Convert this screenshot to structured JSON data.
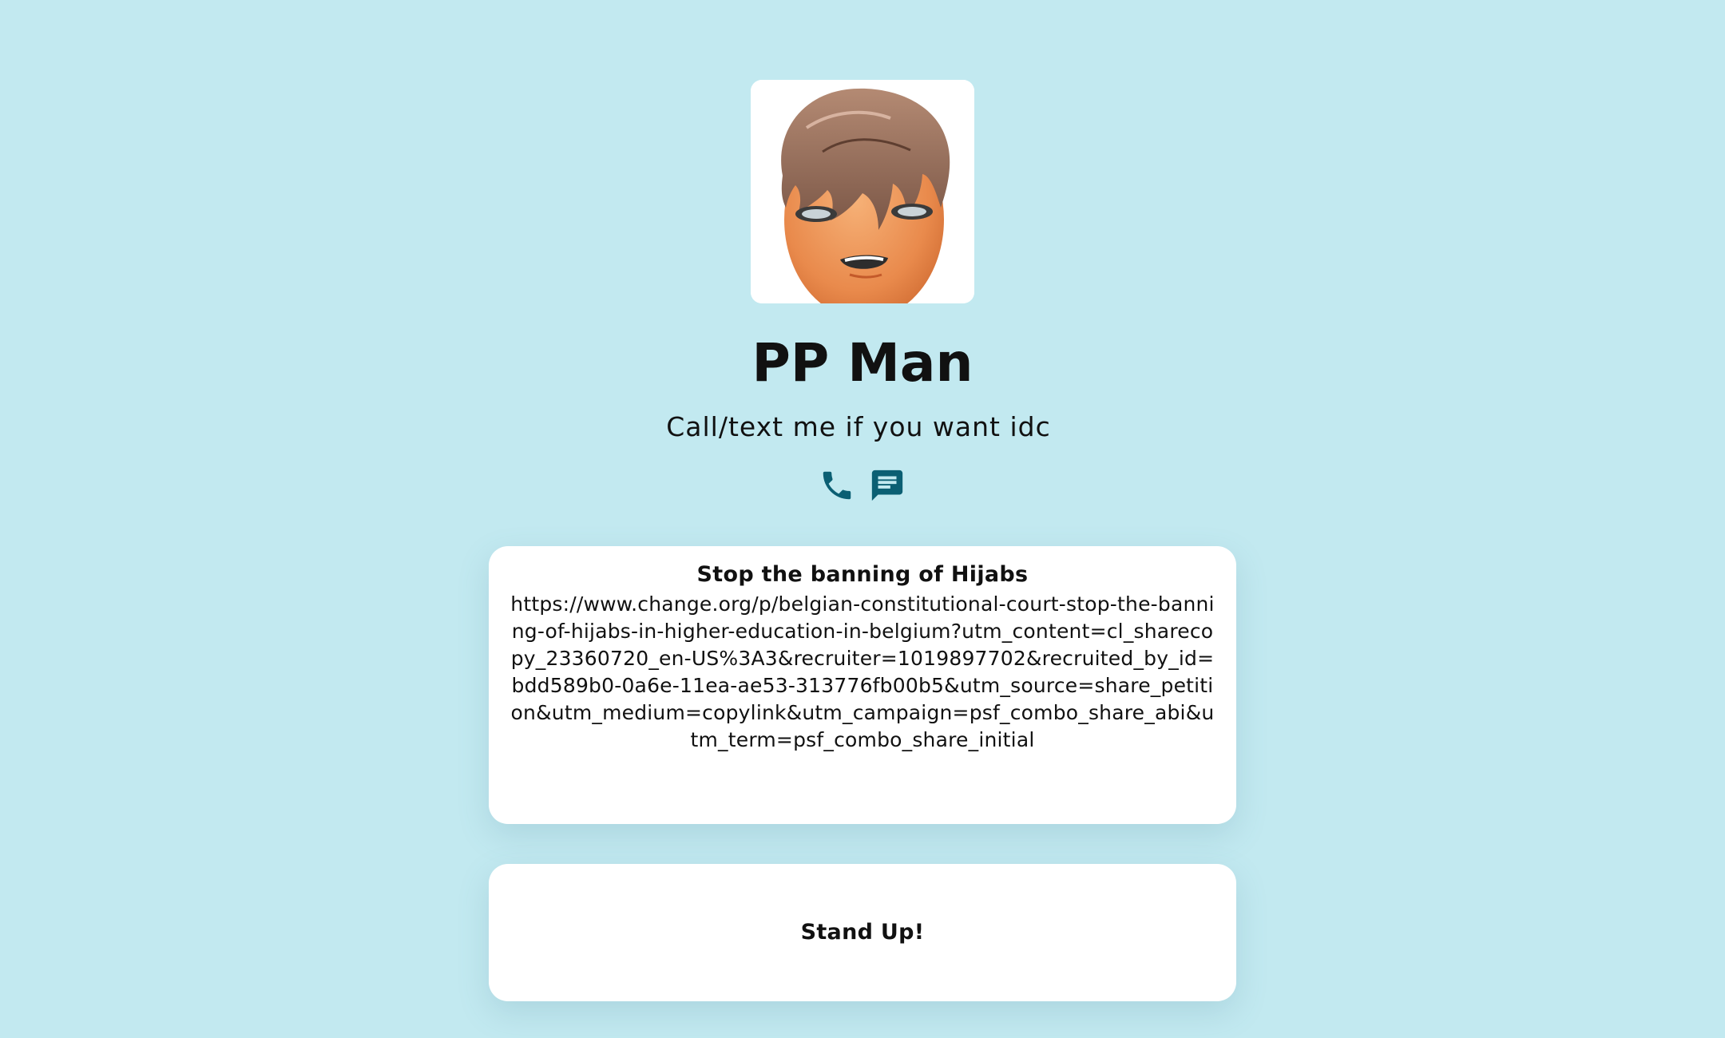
{
  "profile": {
    "name": "PP Man",
    "bio": "Call/text me if you want idc",
    "avatar_icon": "cartoon-avatar"
  },
  "contact": {
    "icons": [
      "phone-icon",
      "message-icon"
    ],
    "icon_color": "#0b5f73"
  },
  "links": [
    {
      "title": "Stop the banning of Hijabs",
      "url": "https://www.change.org/p/belgian-constitutional-court-stop-the-banning-of-hijabs-in-higher-education-in-belgium?utm_content=cl_sharecopy_23360720_en-US%3A3&recruiter=1019897702&recruited_by_id=bdd589b0-0a6e-11ea-ae53-313776fb00b5&utm_source=share_petition&utm_medium=copylink&utm_campaign=psf_combo_share_abi&utm_term=psf_combo_share_initial"
    },
    {
      "title": "Stand Up!"
    }
  ],
  "colors": {
    "background": "#c2e9f0",
    "card": "#ffffff",
    "text": "#111111"
  }
}
